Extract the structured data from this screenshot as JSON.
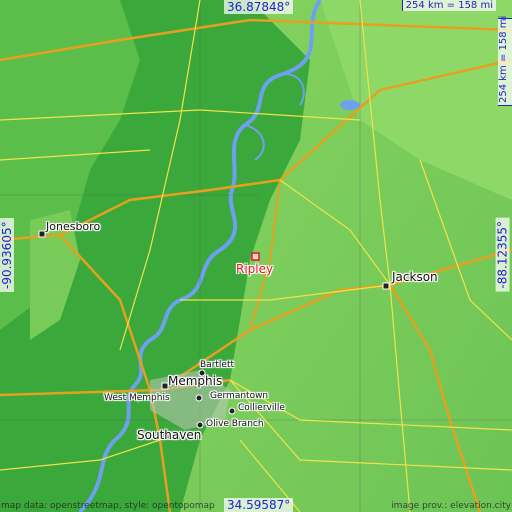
{
  "map": {
    "main_place": "Ripley",
    "cities": [
      {
        "key": "jonesboro",
        "label": "Jonesboro"
      },
      {
        "key": "jackson",
        "label": "Jackson"
      },
      {
        "key": "memphis",
        "label": "Memphis"
      },
      {
        "key": "west_memphis",
        "label": "West Memphis"
      },
      {
        "key": "bartlett",
        "label": "Bartlett"
      },
      {
        "key": "germantown",
        "label": "Germantown"
      },
      {
        "key": "collierville",
        "label": "Collierville"
      },
      {
        "key": "olive_branch",
        "label": "Olive Branch"
      },
      {
        "key": "southaven",
        "label": "Southaven"
      }
    ],
    "coords": {
      "top": "36.87848°",
      "bottom": "34.59587°",
      "left": "-90.93605°",
      "right": "-88.12355°"
    },
    "scale": {
      "horizontal": "254 km = 158 mi",
      "vertical": "254 km = 158 mi"
    },
    "attribution": {
      "left": "map data: openstreetmap, style: opentopomap",
      "right": "image prov.: elevation.city"
    },
    "colors": {
      "lowland": "#3aa83a",
      "upland": "#7fcf5a",
      "river": "#6fa0f0",
      "highway": "#e6a020",
      "road": "#f2e24a",
      "main_marker": "#e21b1b",
      "coord_text": "#2222cc"
    }
  }
}
